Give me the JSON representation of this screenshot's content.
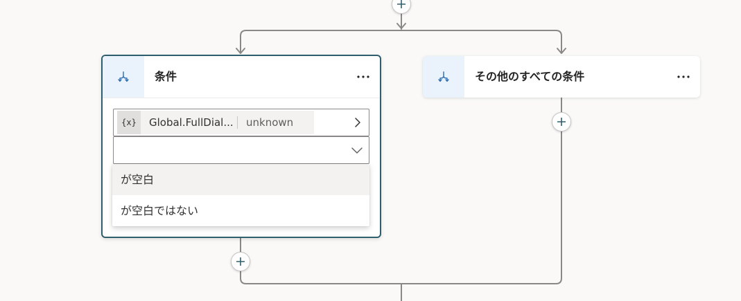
{
  "canvas": {
    "background": "#faf9f8"
  },
  "branches": [
    {
      "title": "条件",
      "icon": "branch-condition-icon",
      "selected": true,
      "condition": {
        "variable_name": "Global.FullDial...",
        "variable_type": "unknown",
        "variable_icon_text": "{x}",
        "operator_value": "",
        "operator_options": [
          {
            "label": "が空白",
            "hovered": true
          },
          {
            "label": "が空白ではない",
            "hovered": false
          }
        ]
      }
    },
    {
      "title": "その他のすべての条件",
      "icon": "branch-condition-icon",
      "selected": false
    }
  ],
  "colors": {
    "accent": "#2f5f6f",
    "icon_blue": "#2b6cb0",
    "icon_box_bg": "#eaf2fb",
    "connector": "#8a8886"
  }
}
